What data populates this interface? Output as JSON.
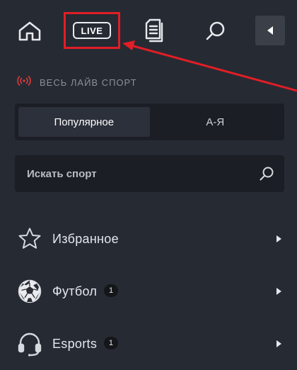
{
  "nav": {
    "home_icon": "home-icon",
    "live_label": "LIVE",
    "betslip_icon": "betslip-icon",
    "search_icon": "search-icon",
    "back_icon": "chevron-left-icon",
    "highlight_color": "#e01e26"
  },
  "section": {
    "title": "ВЕСЬ ЛАЙВ СПОРТ",
    "icon": "broadcast-icon",
    "icon_color": "#e23a3a"
  },
  "tabs": [
    {
      "label": "Популярное",
      "active": true
    },
    {
      "label": "А-Я",
      "active": false
    }
  ],
  "search": {
    "placeholder": "Искать спорт",
    "value": ""
  },
  "sports": [
    {
      "label": "Избранное",
      "icon": "star-icon",
      "count": null
    },
    {
      "label": "Футбол",
      "icon": "soccer-ball-icon",
      "count": "1"
    },
    {
      "label": "Esports",
      "icon": "headset-icon",
      "count": "1"
    }
  ],
  "colors": {
    "background": "#262a33",
    "panel": "#1b1e24",
    "active_tab": "#2c303a",
    "accent": "#e01e26"
  }
}
